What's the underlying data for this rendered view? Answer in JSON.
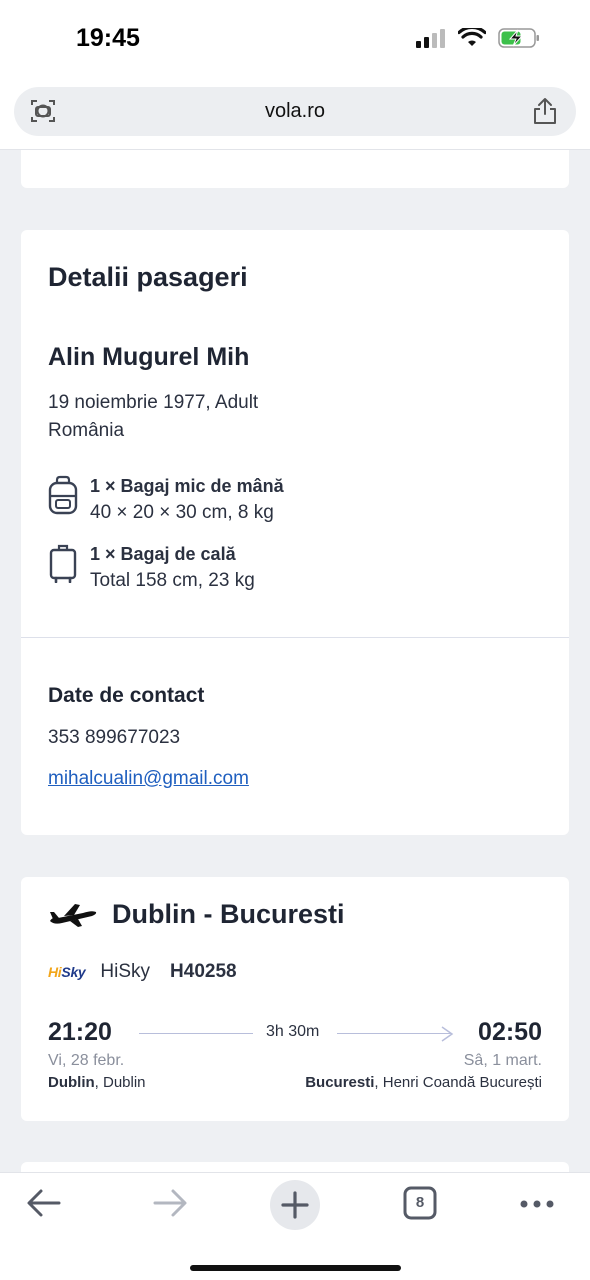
{
  "status_bar": {
    "time": "19:45",
    "icons": [
      "signal-icon",
      "wifi-icon",
      "battery-charging-icon"
    ]
  },
  "browser": {
    "url": "vola.ro",
    "tab_count": "8",
    "toolbar": [
      "back-icon",
      "forward-icon",
      "new-tab-icon",
      "tabs-icon",
      "more-icon"
    ]
  },
  "passengers": {
    "title": "Detalii pasageri",
    "name": "Alin Mugurel Mih",
    "birth_type": "19 noiembrie 1977, Adult",
    "country": "România",
    "bags": [
      {
        "icon": "backpack-icon",
        "title": "1 × Bagaj mic de mână",
        "desc": "40 × 20 × 30 cm, 8 kg"
      },
      {
        "icon": "suitcase-icon",
        "title": "1 × Bagaj de cală",
        "desc": "Total 158 cm, 23 kg"
      }
    ]
  },
  "contact": {
    "title": "Date de contact",
    "phone": "353 899677023",
    "email": "mihalcualin@gmail.com"
  },
  "flight": {
    "route": "Dublin - Bucuresti",
    "airline_logo": {
      "prefix": "Hi",
      "suffix": "Sky"
    },
    "airline": "HiSky",
    "number": "H40258",
    "departure": {
      "time": "21:20",
      "date": "Vi, 28 febr.",
      "city": "Dublin",
      "airport": ", Dublin"
    },
    "duration": "3h 30m",
    "arrival": {
      "time": "02:50",
      "date": "Sâ, 1 mart.",
      "city": "Bucuresti",
      "airport": ", Henri Coandă București"
    }
  },
  "colors": {
    "background": "#eef0f3",
    "card": "#ffffff",
    "text": "#1f2533",
    "link": "#1f5fbf",
    "divider": "#dde0ea"
  }
}
